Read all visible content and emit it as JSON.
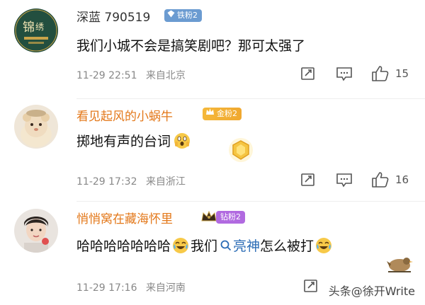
{
  "comments": [
    {
      "username": "深蓝 790519",
      "badge": "铁粉2",
      "text": "我们小城不会是搞笑剧吧？那可太强了",
      "date": "11-29 22:51",
      "location": "来自北京",
      "likes": "15",
      "name_color": "#333333",
      "badge_color": "#6b9bd1"
    },
    {
      "username": "看见起风的小蜗牛",
      "badge": "金粉2",
      "text": "掷地有声的台词",
      "date": "11-29 17:32",
      "location": "来自浙江",
      "likes": "16",
      "name_color": "#e3781a",
      "badge_color": "#f0b030"
    },
    {
      "username": "悄悄窝在藏海怀里",
      "badge": "钻粉2",
      "text_parts": [
        "哈哈哈哈哈哈哈",
        "我们",
        "亮神",
        "怎么被打"
      ],
      "date": "11-29 17:16",
      "location": "来自河南",
      "name_color": "#e3781a",
      "badge_color": "#b16ae0"
    }
  ],
  "watermark": "头条@徐开Write"
}
